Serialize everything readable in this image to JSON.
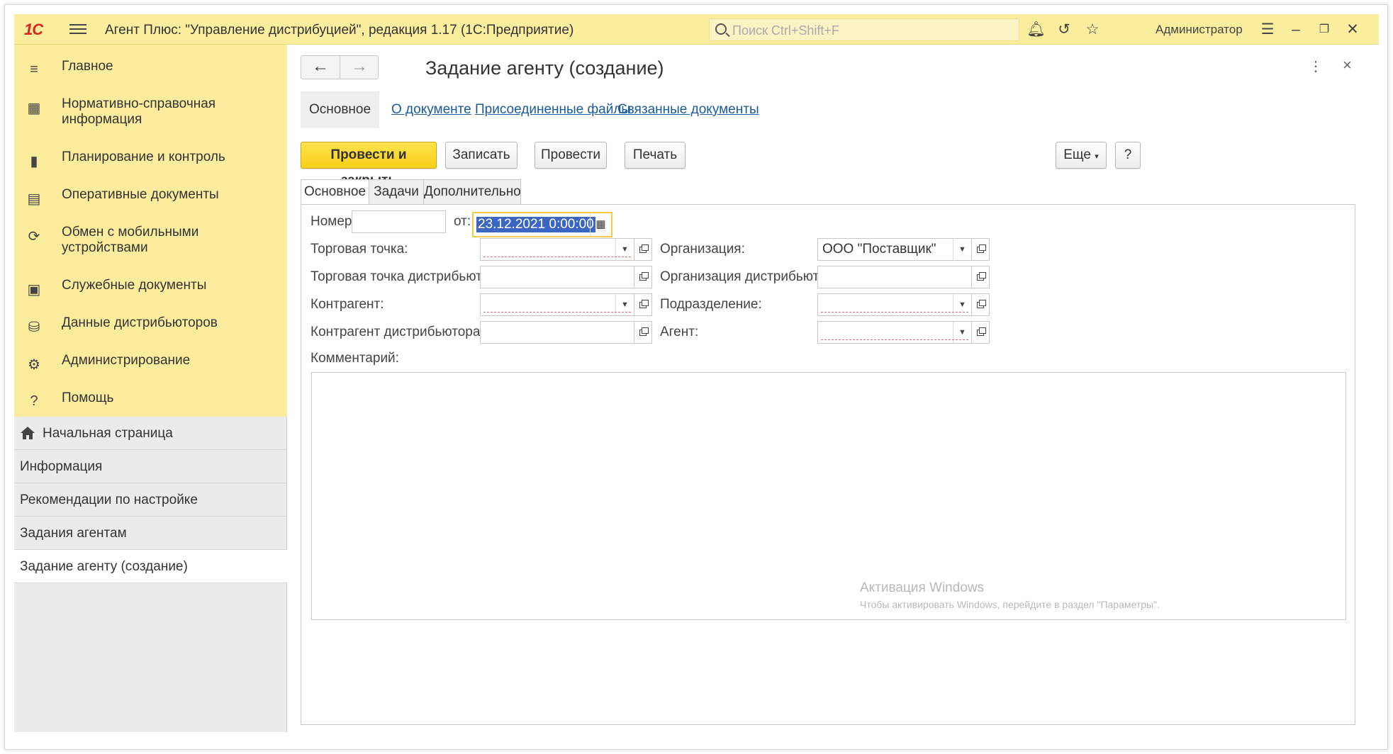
{
  "titlebar": {
    "logo": "1С",
    "app_title": "Агент Плюс: \"Управление дистрибуцией\", редакция 1.17  (1С:Предприятие)",
    "search_placeholder": "Поиск Ctrl+Shift+F",
    "user": "Администратор"
  },
  "sidebar": {
    "items": [
      {
        "label": "Главное",
        "icon": "hamburger-icon"
      },
      {
        "label": "Нормативно-справочная информация",
        "icon": "catalog-icon"
      },
      {
        "label": "Планирование и контроль",
        "icon": "bar-chart-icon"
      },
      {
        "label": "Оперативные документы",
        "icon": "documents-icon"
      },
      {
        "label": "Обмен с мобильными устройствами",
        "icon": "sync-icon"
      },
      {
        "label": "Служебные документы",
        "icon": "service-docs-icon"
      },
      {
        "label": "Данные дистрибьюторов",
        "icon": "distributors-icon"
      },
      {
        "label": "Администрирование",
        "icon": "gear-icon"
      },
      {
        "label": "Помощь",
        "icon": "help-icon"
      }
    ]
  },
  "open_windows": {
    "items": [
      {
        "label": "Начальная страница"
      },
      {
        "label": "Информация"
      },
      {
        "label": "Рекомендации по настройке"
      },
      {
        "label": "Задания агентам"
      },
      {
        "label": "Задание агенту (создание)"
      }
    ]
  },
  "doc": {
    "title": "Задание агенту (создание)",
    "tablinks": [
      "Основное",
      "О документе",
      "Присоединенные файлы",
      "Связанные документы"
    ],
    "buttons": {
      "post_close": "Провести и закрыть",
      "save": "Записать",
      "post": "Провести",
      "print": "Печать",
      "more": "Еще",
      "help": "?"
    },
    "tabs": [
      "Основное",
      "Задачи",
      "Дополнительно"
    ],
    "fields": {
      "number_label": "Номер:",
      "number_value": "",
      "date_from_label": "от:",
      "date_value": "23.12.2021  0:00:00",
      "outlet_label": "Торговая точка:",
      "outlet_dist_label": "Торговая точка дистрибьютора:",
      "counterparty_label": "Контрагент:",
      "counterparty_dist_label": "Контрагент дистрибьютора:",
      "org_label": "Организация:",
      "org_value": "ООО \"Поставщик\"",
      "org_dist_label": "Организация дистрибьютора:",
      "division_label": "Подразделение:",
      "agent_label": "Агент:",
      "comment_label": "Комментарий:"
    },
    "watermark": {
      "line1": "Активация Windows",
      "line2": "Чтобы активировать Windows, перейдите в раздел \"Параметры\"."
    }
  }
}
